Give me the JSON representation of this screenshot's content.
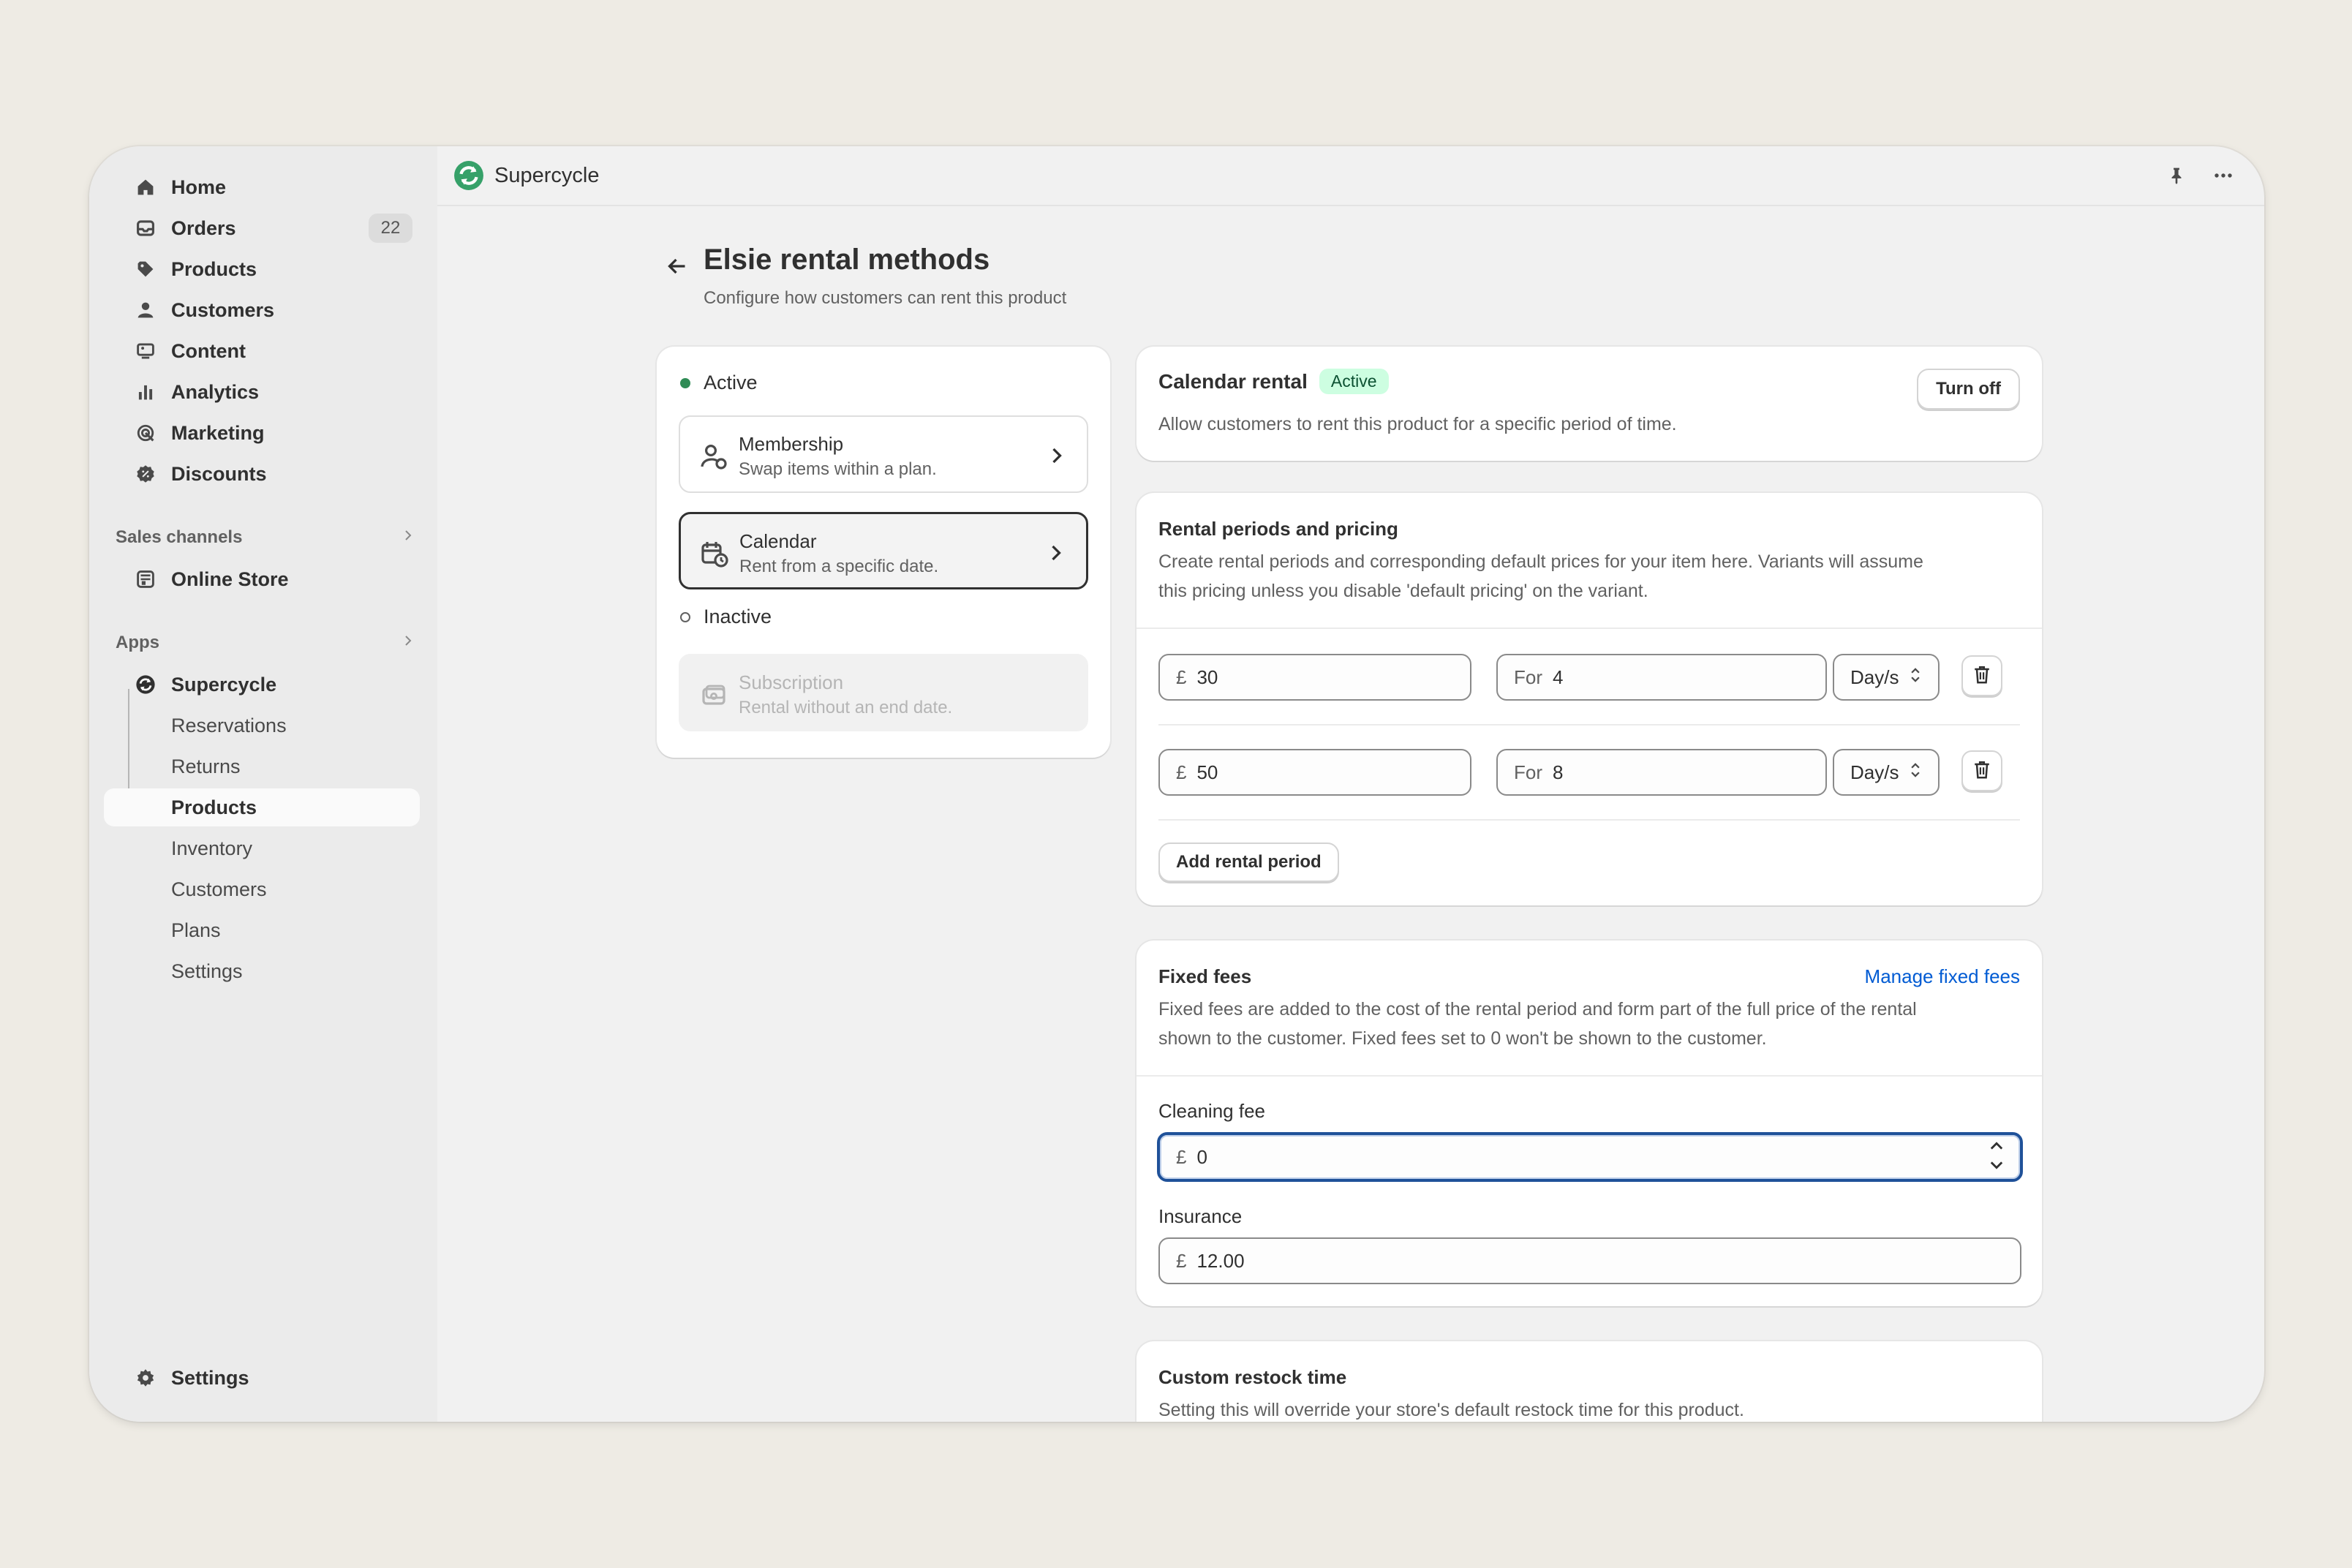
{
  "sidebar": {
    "items": [
      {
        "label": "Home",
        "icon": "home-icon"
      },
      {
        "label": "Orders",
        "icon": "orders-icon",
        "badge": "22"
      },
      {
        "label": "Products",
        "icon": "tag-icon"
      },
      {
        "label": "Customers",
        "icon": "person-icon"
      },
      {
        "label": "Content",
        "icon": "content-icon"
      },
      {
        "label": "Analytics",
        "icon": "bar-chart-icon"
      },
      {
        "label": "Marketing",
        "icon": "target-icon"
      },
      {
        "label": "Discounts",
        "icon": "discount-icon"
      }
    ],
    "sales_channels": {
      "heading": "Sales channels",
      "items": [
        {
          "label": "Online Store",
          "icon": "store-icon"
        }
      ]
    },
    "apps": {
      "heading": "Apps",
      "app": {
        "label": "Supercycle",
        "icon": "supercycle-icon"
      },
      "subitems": [
        "Reservations",
        "Returns",
        "Products",
        "Inventory",
        "Customers",
        "Plans",
        "Settings"
      ],
      "selected": "Products"
    },
    "settings": {
      "label": "Settings",
      "icon": "gear-icon"
    }
  },
  "topbar": {
    "app_name": "Supercycle",
    "pin_icon": "pin-icon",
    "more_icon": "more-icon"
  },
  "page": {
    "title": "Elsie rental methods",
    "subtitle": "Configure how customers can rent this product"
  },
  "methods": {
    "active_label": "Active",
    "inactive_label": "Inactive",
    "items": [
      {
        "title": "Membership",
        "desc": "Swap items within a plan.",
        "icon": "membership-icon"
      },
      {
        "title": "Calendar",
        "desc": "Rent from a specific date.",
        "icon": "calendar-icon"
      },
      {
        "title": "Subscription",
        "desc": "Rental without an end date.",
        "icon": "subscription-icon"
      }
    ]
  },
  "calendar_rental": {
    "title": "Calendar rental",
    "badge": "Active",
    "description": "Allow customers to rent this product for a specific period of time.",
    "turn_off": "Turn off"
  },
  "rental_periods": {
    "title": "Rental periods and pricing",
    "description_1": "Create rental periods and corresponding default prices for your item here. Variants will assume",
    "description_2": "this pricing unless you disable 'default pricing' on the variant.",
    "currency": "£",
    "for_label": "For",
    "rows": [
      {
        "price": "30",
        "duration": "4",
        "unit": "Day/s"
      },
      {
        "price": "50",
        "duration": "8",
        "unit": "Day/s"
      }
    ],
    "add_button": "Add rental period"
  },
  "fixed_fees": {
    "title": "Fixed fees",
    "manage_link": "Manage fixed fees",
    "description_1": "Fixed fees are added to the cost of the rental period and form part of the full price of the rental",
    "description_2": "shown to the customer. Fixed fees set to 0 won't be shown to the customer.",
    "currency": "£",
    "cleaning_label": "Cleaning fee",
    "cleaning_value": "0",
    "insurance_label": "Insurance",
    "insurance_value": "12.00"
  },
  "restock": {
    "title": "Custom restock time",
    "description": "Setting this will override your store's default restock time for this product."
  },
  "colors": {
    "accent_link": "#005bd3",
    "active_green": "#2f8b55",
    "focus_blue": "#1f5199",
    "app_logo": "#36a169"
  }
}
